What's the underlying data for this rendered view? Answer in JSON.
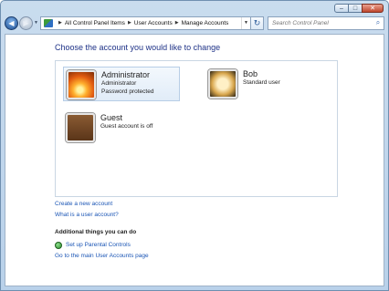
{
  "window": {
    "minimize_label": "–",
    "maximize_label": "□",
    "close_label": "✕"
  },
  "nav": {
    "back_glyph": "◀",
    "forward_glyph": "▶",
    "history_dropdown_glyph": "▼"
  },
  "breadcrumb": {
    "items": [
      "All Control Panel Items",
      "User Accounts",
      "Manage Accounts"
    ],
    "separator": "▶",
    "dropdown_glyph": "▼",
    "refresh_glyph": "↻"
  },
  "search": {
    "placeholder": "Search Control Panel",
    "icon": "search-icon"
  },
  "page": {
    "title": "Choose the account you would like to change"
  },
  "accounts": [
    {
      "name": "Administrator",
      "lines": [
        "Administrator",
        "Password protected"
      ],
      "picture": "flower"
    },
    {
      "name": "Bob",
      "lines": [
        "Standard user"
      ],
      "picture": "shell"
    },
    {
      "name": "Guest",
      "lines": [
        "Guest account is off"
      ],
      "picture": "briefcase"
    }
  ],
  "links": {
    "create_account": "Create a new account",
    "what_is_account": "What is a user account?"
  },
  "additional": {
    "heading": "Additional things you can do",
    "parental_controls": "Set up Parental Controls",
    "main_page": "Go to the main User Accounts page"
  },
  "colors": {
    "link": "#1a55b5",
    "title": "#1e3287",
    "selection": "#e1ecf8"
  }
}
